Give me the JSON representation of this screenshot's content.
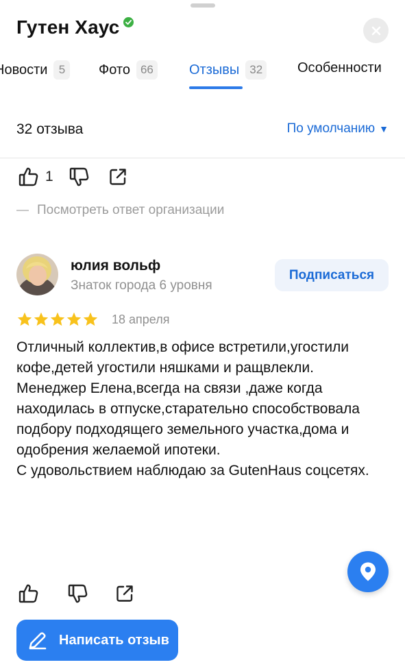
{
  "org": {
    "name": "Гутен Хаус",
    "verified_color": "#3cb043"
  },
  "tabs": [
    {
      "label": "Новости",
      "count": "5",
      "active": false
    },
    {
      "label": "Фото",
      "count": "66",
      "active": false
    },
    {
      "label": "Отзывы",
      "count": "32",
      "active": true
    },
    {
      "label": "Особенности",
      "count": "",
      "active": false
    }
  ],
  "reviews_header": {
    "count_label": "32 отзыва",
    "sort_label": "По умолчанию",
    "sort_caret": "▼"
  },
  "prev_review": {
    "likes": "1",
    "org_reply_link": "Посмотреть ответ организации"
  },
  "review": {
    "author_name": "юлия вольф",
    "author_level": "Знаток города 6 уровня",
    "subscribe_label": "Подписаться",
    "rating": 5,
    "date": "18 апреля",
    "text_lines": [
      "Отличный коллектив,в офисе встретили,угостили кофе,детей угостили няшками и ращвлекли.",
      "Менеджер Елена,всегда на связи ,даже когда находилась в отпуске,старательно способствовала подбору подходящего земельного участка,дома и одобрения желаемой ипотеки.",
      "С удовольствием наблюдаю за GutenHaus соцсетях."
    ]
  },
  "write_review_label": "Написать отзыв",
  "icons": {
    "close": "close-icon",
    "like": "thumbs-up-icon",
    "dislike": "thumbs-down-icon",
    "share": "share-icon",
    "map": "map-pin-icon",
    "pen": "pencil-icon",
    "star": "star-icon"
  },
  "colors": {
    "accent": "#2b7ff0",
    "link": "#1a6ad6",
    "star": "#f8c21c",
    "muted": "#909090"
  }
}
